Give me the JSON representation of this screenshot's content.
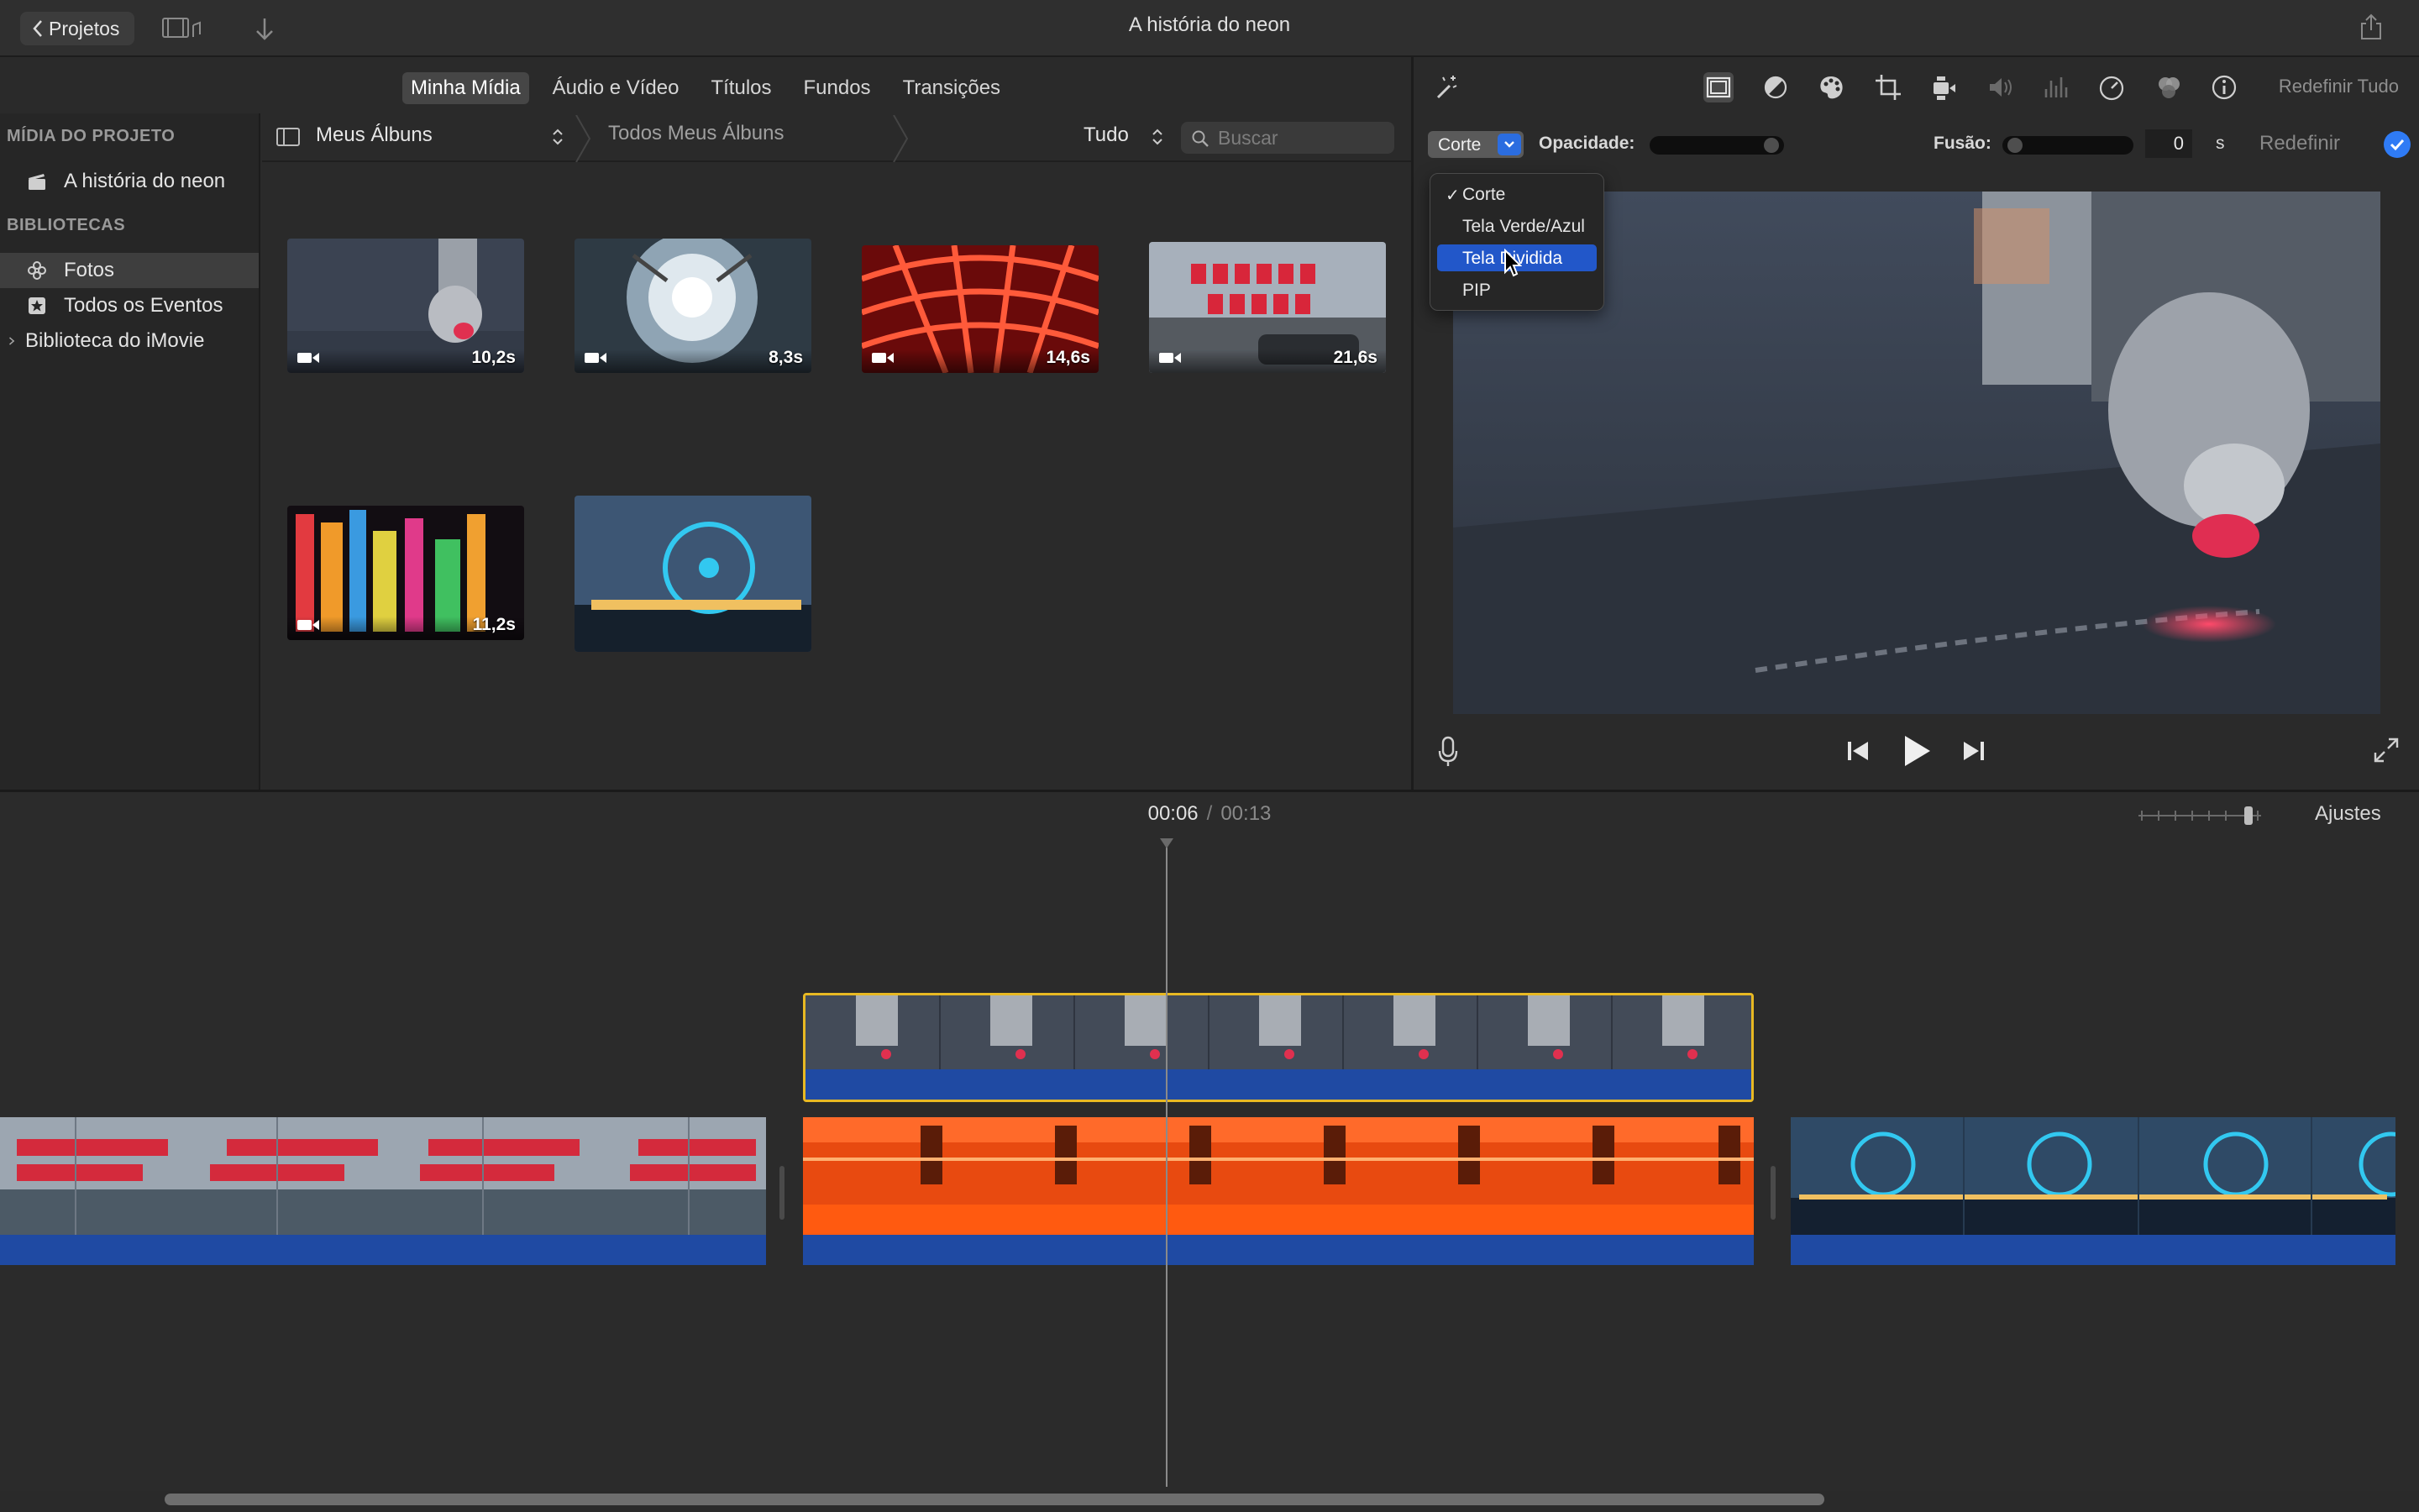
{
  "app": {
    "back_label": "Projetos",
    "title": "A história do neon"
  },
  "browser_tabs": [
    "Minha Mídia",
    "Áudio e Vídeo",
    "Títulos",
    "Fundos",
    "Transições"
  ],
  "sidebar": {
    "project_header": "MÍDIA DO PROJETO",
    "project_item": "A história do neon",
    "libraries_header": "BIBLIOTECAS",
    "items": [
      {
        "label": "Fotos",
        "icon": "photos-icon",
        "selected": true
      },
      {
        "label": "Todos os Eventos",
        "icon": "star-icon",
        "selected": false
      },
      {
        "label": "Biblioteca do iMovie",
        "icon": "disclosure-icon",
        "selected": false
      }
    ]
  },
  "browser_bar": {
    "album": "Meus Álbuns",
    "breadcrumb": "Todos Meus Álbuns",
    "filter": "Tudo",
    "search_placeholder": "Buscar"
  },
  "media": [
    {
      "duration": "10,2s",
      "scene": "laser"
    },
    {
      "duration": "8,3s",
      "scene": "lamp"
    },
    {
      "duration": "14,6s",
      "scene": "neon-grid"
    },
    {
      "duration": "21,6s",
      "scene": "market"
    },
    {
      "duration": "11,2s",
      "scene": "signs"
    },
    {
      "duration": "",
      "scene": "ferris"
    }
  ],
  "inspector": {
    "reset_all": "Redefinir Tudo",
    "tools": [
      "magic-wand-icon",
      "overlay-icon",
      "color-balance-icon",
      "color-palette-icon",
      "crop-icon",
      "stabilization-icon",
      "volume-icon",
      "equalizer-icon",
      "speed-icon",
      "filter-icon",
      "info-icon"
    ],
    "overlay_value": "Corte",
    "opacity_label": "Opacidade:",
    "opacity": 1.0,
    "fusion_label": "Fusão:",
    "fusion_value": "0",
    "fusion_unit": "s",
    "reset": "Redefinir"
  },
  "overlay_menu": {
    "items": [
      {
        "label": "Corte",
        "checked": true,
        "highlighted": false
      },
      {
        "label": "Tela Verde/Azul",
        "checked": false,
        "highlighted": false
      },
      {
        "label": "Tela Dividida",
        "checked": false,
        "highlighted": true
      },
      {
        "label": "PIP",
        "checked": false,
        "highlighted": false
      }
    ],
    "check_glyph": "✓"
  },
  "timeline": {
    "current": "00:06",
    "separator": "/",
    "total": "00:13",
    "adjust": "Ajustes",
    "overlay_clip": {
      "scene": "laser",
      "selected": true
    },
    "clips": [
      {
        "scene": "market"
      },
      {
        "scene": "neon-orange"
      },
      {
        "scene": "ferris"
      }
    ]
  },
  "colors": {
    "accent": "#2f7bf5",
    "selection_outline": "#e8b923",
    "audio_track": "#1f4aa3"
  }
}
